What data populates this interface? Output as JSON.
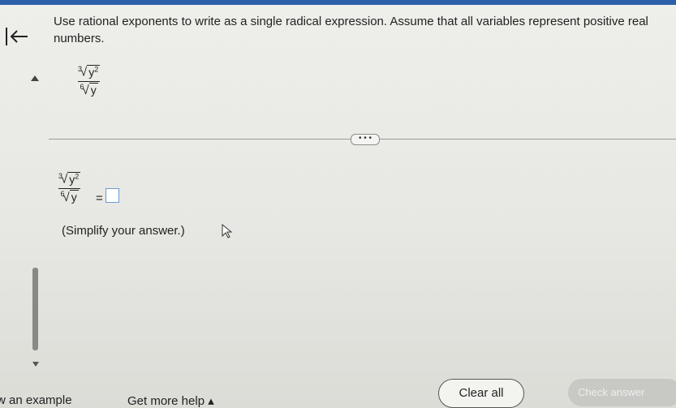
{
  "navigation": {
    "back_icon": "arrow-left-icon"
  },
  "question": {
    "instructions": "Use rational exponents to write as a single radical expression. Assume that all variables represent positive real numbers."
  },
  "expression": {
    "num_index": "3",
    "num_radicand": "y",
    "num_exponent": "2",
    "den_index": "6",
    "den_radicand": "y"
  },
  "answer": {
    "equals": "=",
    "hint": "(Simplify your answer.)"
  },
  "more_button": "• • •",
  "footer": {
    "view_example": "w an example",
    "get_more_help": "Get more help ▴",
    "clear_all": "Clear all",
    "check_answer": "Check answer"
  },
  "colors": {
    "accent": "#2b5fa8",
    "input_border": "#6d9ad2"
  }
}
